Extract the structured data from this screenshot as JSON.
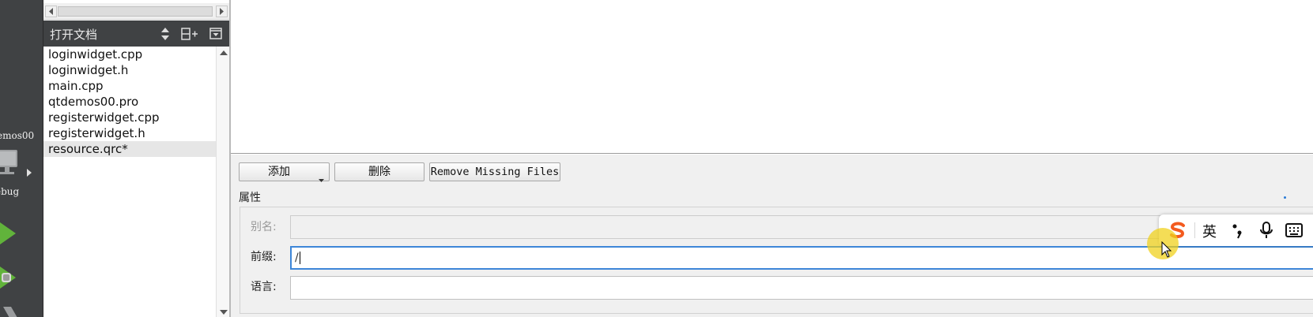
{
  "modebar": {
    "project_name": "emos00",
    "build_config": "ebug",
    "icons": [
      "monitor-icon",
      "play-icon",
      "debug-run-icon",
      "build-hammer-icon"
    ],
    "colors": {
      "background": "#404244",
      "run_green": "#61b33b"
    }
  },
  "open_documents": {
    "title": "打开文档",
    "icons": [
      "sort-updown-icon",
      "split-icon",
      "close-panel-icon"
    ],
    "files": [
      {
        "name": "loginwidget.cpp"
      },
      {
        "name": "loginwidget.h"
      },
      {
        "name": "main.cpp"
      },
      {
        "name": "qtdemos00.pro"
      },
      {
        "name": "registerwidget.cpp"
      },
      {
        "name": "registerwidget.h"
      },
      {
        "name": "resource.qrc*",
        "selected": true
      }
    ]
  },
  "toolbar": {
    "add_label": "添加",
    "delete_label": "删除",
    "remove_missing_label": "Remove Missing Files"
  },
  "properties": {
    "title": "属性",
    "alias_label": "别名:",
    "alias_value": "",
    "prefix_label": "前缀:",
    "prefix_value": "/",
    "language_label": "语言:",
    "language_value": ""
  },
  "ime": {
    "lang": "英",
    "icons": [
      "sogou-logo-icon",
      "punctuation-icon",
      "microphone-icon",
      "keyboard-icon"
    ],
    "colors": {
      "logo": "#f35b1f"
    }
  },
  "colors": {
    "focus_border": "#3d86d8",
    "cursor_highlight": "#f0d21e"
  }
}
